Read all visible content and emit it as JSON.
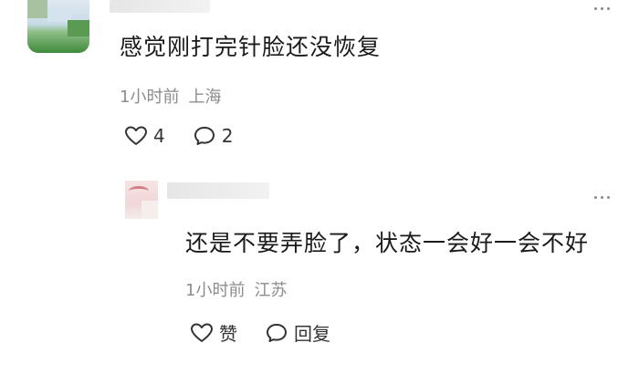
{
  "comment": {
    "text": "感觉刚打完针脸还没恢复",
    "time": "1小时前",
    "location": "上海",
    "like_count": "4",
    "reply_count": "2"
  },
  "reply": {
    "text": "还是不要弄脸了，状态一会好一会不好",
    "time": "1小时前",
    "location": "江苏",
    "like_label": "赞",
    "reply_label": "回复"
  },
  "icons": {
    "like": "heart-outline-icon",
    "reply": "speech-bubble-icon",
    "more": "more-dots-icon"
  },
  "colors": {
    "meta_text": "#8c8c8c",
    "body_text": "#1a1a1a"
  }
}
